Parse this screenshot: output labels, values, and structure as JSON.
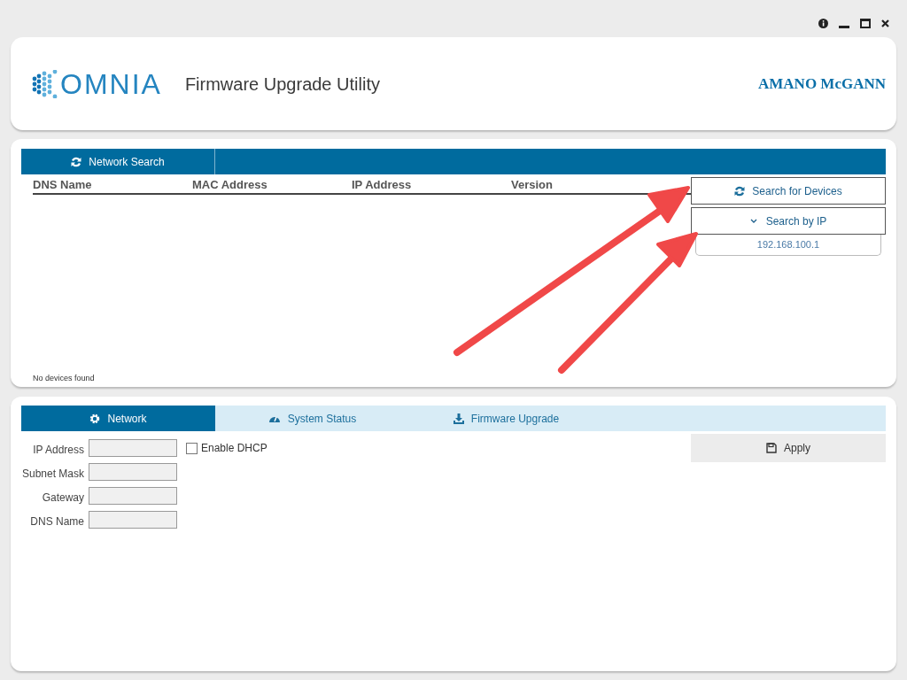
{
  "header": {
    "logo_text": "OMNIA",
    "title": "Firmware Upgrade Utility",
    "brand": "AMANO McGANN"
  },
  "search_panel": {
    "tabs": [
      {
        "label": "Network Search",
        "selected": true
      }
    ],
    "columns": [
      "DNS Name",
      "MAC Address",
      "IP Address",
      "Version"
    ],
    "status": "No devices found",
    "search_button": "Search for Devices",
    "search_by_ip": {
      "label": "Search by IP",
      "expanded": true,
      "value": "192.168.100.1"
    }
  },
  "settings_panel": {
    "tabs": [
      {
        "label": "Network",
        "selected": true
      },
      {
        "label": "System Status",
        "selected": false
      },
      {
        "label": "Firmware Upgrade",
        "selected": false
      }
    ],
    "fields": [
      {
        "label": "IP Address"
      },
      {
        "label": "Subnet Mask"
      },
      {
        "label": "Gateway"
      },
      {
        "label": "DNS Name"
      }
    ],
    "dhcp": {
      "label": "Enable DHCP",
      "checked": false
    },
    "apply_button": "Apply"
  }
}
